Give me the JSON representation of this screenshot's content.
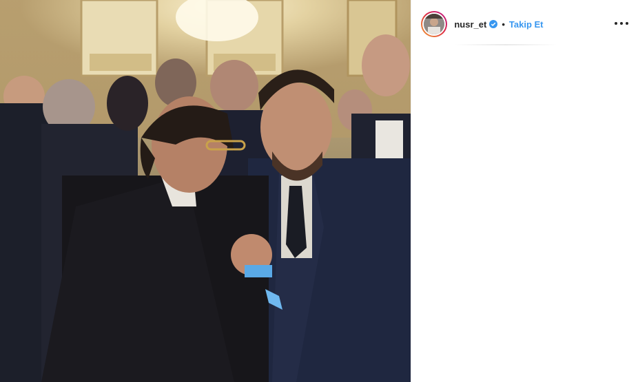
{
  "post": {
    "username": "nusr_et",
    "separator": "•",
    "follow_label": "Takip Et",
    "verified": true
  },
  "colors": {
    "follow_blue": "#3897f0",
    "verified_blue": "#3897f0",
    "text_dark": "#262626"
  },
  "icons": {
    "verified": "verified-badge-icon",
    "more": "more-options-icon"
  }
}
